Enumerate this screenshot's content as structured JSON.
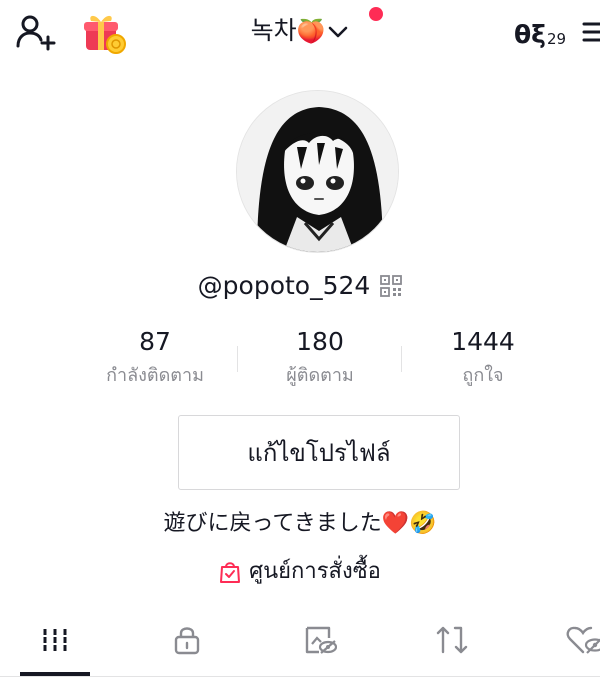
{
  "header": {
    "title": "녹차",
    "title_emoji": "🍑",
    "creator_glyph": "θξ",
    "creator_count": "29",
    "icons": [
      "add-user-icon",
      "gift-icon",
      "chevron-down-icon",
      "notification-dot",
      "creator-tools-icon",
      "menu-icon"
    ]
  },
  "profile": {
    "handle": "@popoto_524"
  },
  "stats": [
    {
      "value": "87",
      "label": "กำลังติดตาม"
    },
    {
      "value": "180",
      "label": "ผู้ติดตาม"
    },
    {
      "value": "1444",
      "label": "ถูกใจ"
    }
  ],
  "edit_button_label": "แก้ไขโปรไฟล์",
  "bio": "遊びに戻ってきました❤️🤣",
  "shop": {
    "label": "ศูนย์การสั่งซื้อ",
    "icon": "shopping-bag-icon"
  },
  "tabs": [
    {
      "icon": "grid-icon",
      "active": true
    },
    {
      "icon": "lock-icon",
      "active": false
    },
    {
      "icon": "tagged-photo-icon",
      "active": false
    },
    {
      "icon": "repost-icon",
      "active": false
    },
    {
      "icon": "liked-hidden-icon",
      "active": false
    }
  ],
  "colors": {
    "accent": "#fe2c55",
    "text": "#161823",
    "secondary_text": "#8a8b91",
    "border": "#d8d8da"
  }
}
